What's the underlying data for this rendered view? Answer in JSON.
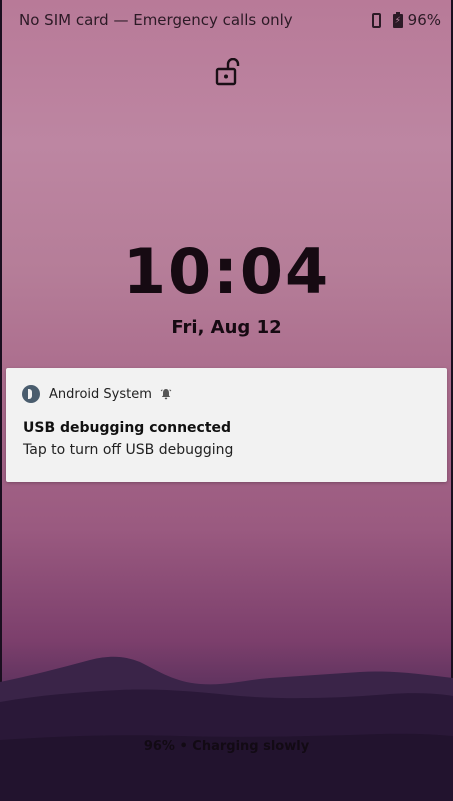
{
  "status_bar": {
    "carrier": "No SIM card — Emergency calls only",
    "battery_percent": "96%"
  },
  "lock_screen": {
    "lock_icon": "unlocked-padlock-icon",
    "time": "10:04",
    "date": "Fri, Aug 12",
    "charging_status": "96% • Charging slowly"
  },
  "notification": {
    "app_name": "Android System",
    "app_icon": "android-system-icon",
    "alert_icon": "bell-icon",
    "title": "USB debugging connected",
    "text": "Tap to turn off USB debugging"
  },
  "colors": {
    "wallpaper_top": "#b87a98",
    "wallpaper_bottom": "#2d1a38",
    "notification_bg": "#f2f2f2"
  }
}
